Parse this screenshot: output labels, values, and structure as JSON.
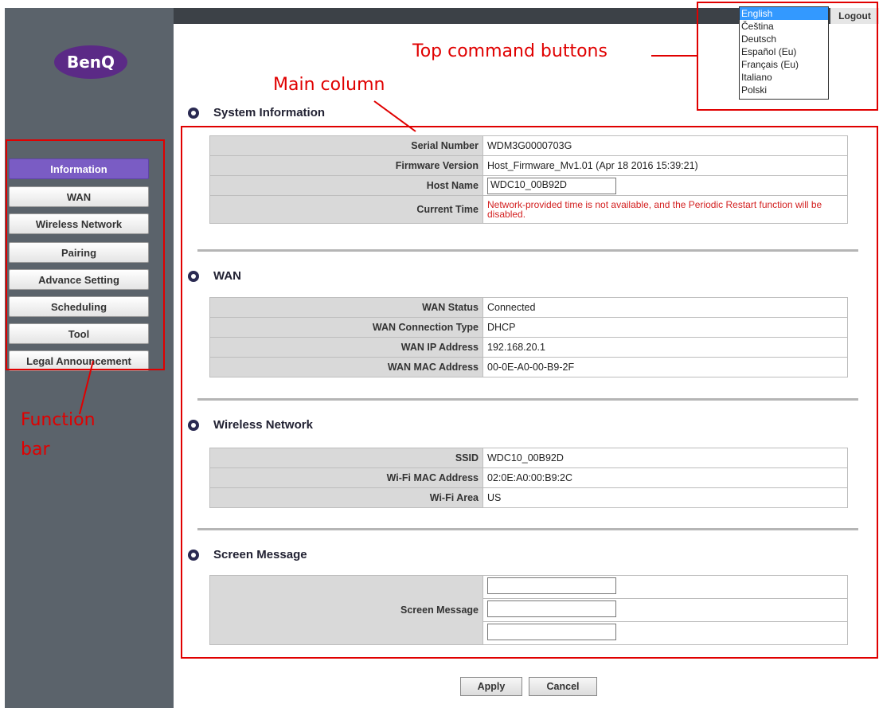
{
  "brand": {
    "logo_text": "BenQ"
  },
  "sidebar": {
    "items": [
      {
        "label": "Information",
        "active": true
      },
      {
        "label": "WAN"
      },
      {
        "label": "Wireless Network"
      },
      {
        "label": "Pairing"
      },
      {
        "label": "Advance Setting"
      },
      {
        "label": "Scheduling"
      },
      {
        "label": "Tool"
      },
      {
        "label": "Legal Announcement"
      }
    ]
  },
  "topbar": {
    "logout_label": "Logout",
    "languages": [
      "English",
      "Čeština",
      "Deutsch",
      "Español (Eu)",
      "Français (Eu)",
      "Italiano",
      "Polski"
    ],
    "selected_language": "English"
  },
  "system_info": {
    "title": "System Information",
    "rows": [
      {
        "label": "Serial Number",
        "value": "WDM3G0000703G"
      },
      {
        "label": "Firmware Version",
        "value": "Host_Firmware_Mv1.01 (Apr 18 2016 15:39:21)"
      },
      {
        "label": "Host Name",
        "value": "WDC10_00B92D"
      },
      {
        "label": "Current Time",
        "value": "Network-provided time is not available, and the Periodic Restart function will be disabled."
      }
    ]
  },
  "wan": {
    "title": "WAN",
    "rows": [
      {
        "label": "WAN Status",
        "value": "Connected"
      },
      {
        "label": "WAN Connection Type",
        "value": "DHCP"
      },
      {
        "label": "WAN IP Address",
        "value": "192.168.20.1"
      },
      {
        "label": "WAN MAC Address",
        "value": "00-0E-A0-00-B9-2F"
      }
    ]
  },
  "wireless": {
    "title": "Wireless Network",
    "rows": [
      {
        "label": "SSID",
        "value": "WDC10_00B92D"
      },
      {
        "label": "Wi-Fi MAC Address",
        "value": "02:0E:A0:00:B9:2C"
      },
      {
        "label": "Wi-Fi Area",
        "value": "US"
      }
    ]
  },
  "screen_message": {
    "title": "Screen Message",
    "label": "Screen Message",
    "inputs": [
      "",
      "",
      ""
    ]
  },
  "actions": {
    "apply_label": "Apply",
    "cancel_label": "Cancel"
  },
  "annotations": {
    "top_command": "Top command buttons",
    "main_column": "Main column",
    "function_bar_line1": "Function",
    "function_bar_line2": "bar"
  },
  "colors": {
    "sidebar_bg": "#5b636b",
    "active_nav": "#7a5cc4",
    "annotation_red": "#e00000",
    "warning_text": "#d32020"
  }
}
